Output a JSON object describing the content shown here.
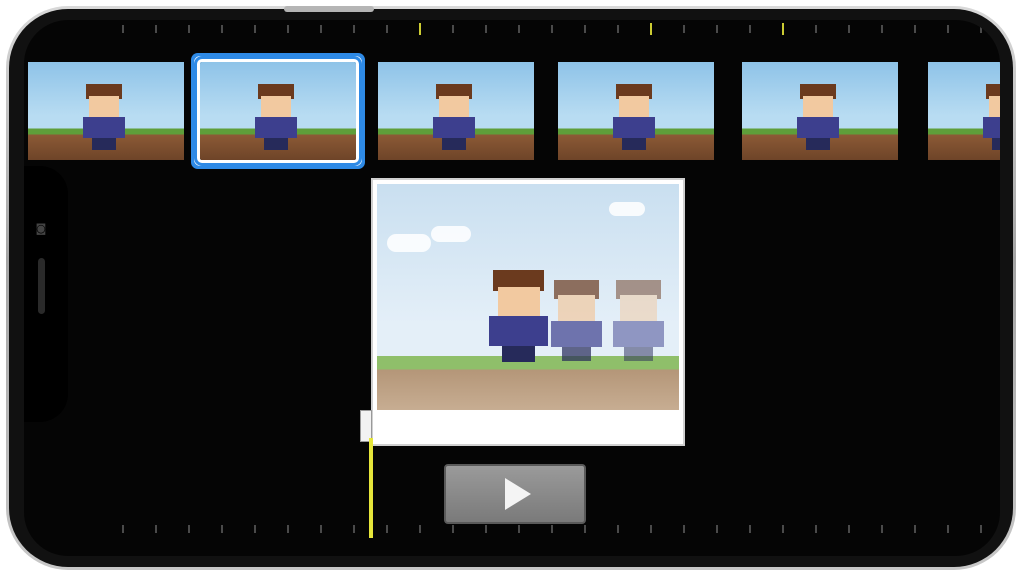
{
  "app": {
    "colors": {
      "background": "#050505",
      "selection": "#2e8ae6",
      "playhead": "#e6e63a",
      "play_button": "#8a8a8a"
    }
  },
  "filmstrip": {
    "frame_count": 6,
    "selected_index": 1
  },
  "preview": {
    "scene": "pixel-art-characters"
  },
  "transport": {
    "play_icon": "play-icon"
  }
}
